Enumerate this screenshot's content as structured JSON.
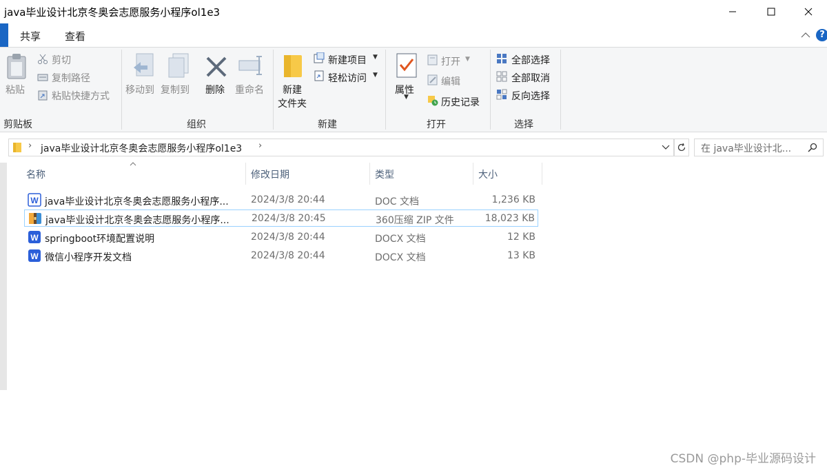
{
  "window": {
    "title": "java毕业设计北京冬奥会志愿服务小程序ol1e3"
  },
  "tabs": [
    {
      "label": "共享"
    },
    {
      "label": "查看"
    }
  ],
  "ribbon": {
    "clipboard": {
      "paste": "粘贴",
      "cut": "剪切",
      "copy_path": "复制路径",
      "paste_shortcut": "粘贴快捷方式",
      "group": "剪贴板"
    },
    "organize": {
      "move_to": "移动到",
      "copy_to": "复制到",
      "delete": "删除",
      "rename": "重命名",
      "group": "组织"
    },
    "new": {
      "new_item": "新建项目",
      "easy_access": "轻松访问",
      "new_folder_line1": "新建",
      "new_folder_line2": "文件夹",
      "group": "新建"
    },
    "open": {
      "properties": "属性",
      "open": "打开",
      "edit": "编辑",
      "history": "历史记录",
      "group": "打开"
    },
    "select": {
      "select_all": "全部选择",
      "select_none": "全部取消",
      "invert": "反向选择",
      "group": "选择"
    }
  },
  "address": {
    "path": "java毕业设计北京冬奥会志愿服务小程序ol1e3",
    "search_placeholder": "在 java毕业设计北..."
  },
  "columns": {
    "name": "名称",
    "date": "修改日期",
    "type": "类型",
    "size": "大小"
  },
  "files": [
    {
      "name": "java毕业设计北京冬奥会志愿服务小程序...",
      "date": "2024/3/8 20:44",
      "type": "DOC 文档",
      "size": "1,236 KB",
      "icon": "word-doc-icon"
    },
    {
      "name": "java毕业设计北京冬奥会志愿服务小程序...",
      "date": "2024/3/8 20:45",
      "type": "360压缩 ZIP 文件",
      "size": "18,023 KB",
      "icon": "zip-archive-icon"
    },
    {
      "name": "springboot环境配置说明",
      "date": "2024/3/8 20:44",
      "type": "DOCX 文档",
      "size": "12 KB",
      "icon": "word-docx-icon"
    },
    {
      "name": "微信小程序开发文档",
      "date": "2024/3/8 20:44",
      "type": "DOCX 文档",
      "size": "13 KB",
      "icon": "word-docx-icon"
    }
  ],
  "watermark": "CSDN @php-毕业源码设计",
  "colors": {
    "accent": "#0078d7",
    "selection_border": "#99d1ff",
    "word_blue": "#2b5fd9",
    "folder_yellow": "#f7c948"
  }
}
